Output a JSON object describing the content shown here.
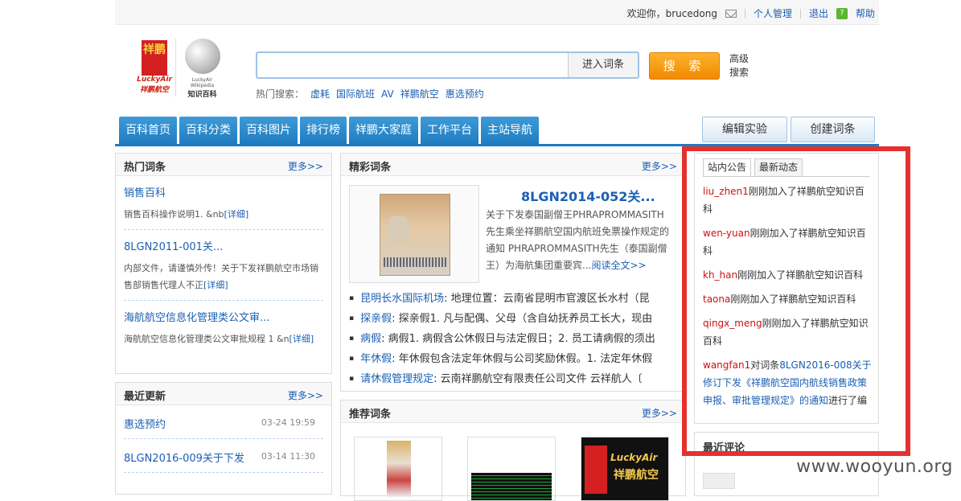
{
  "topbar": {
    "welcome": "欢迎你，brucedong",
    "mail_icon": "mail-icon",
    "personal": "个人管理",
    "logout": "退出",
    "help_icon": "?",
    "help": "帮助"
  },
  "logo": {
    "airline_chars": "祥鹏",
    "airline_en": "LuckyAir",
    "airline_cn": "祥鹏航空",
    "wiki_en": "LuckyAir Wikipedia",
    "wiki_cn": "知识百科"
  },
  "search": {
    "placeholder": "",
    "enter_label": "进入词条",
    "button": "搜 索",
    "advanced": "高级搜索",
    "hot_label": "热门搜索：",
    "hot_terms": [
      "虚耗",
      "国际航班",
      "AV",
      "祥鹏航空",
      "惠选预约"
    ]
  },
  "nav": {
    "items": [
      "百科首页",
      "百科分类",
      "百科图片",
      "排行榜",
      "祥鹏大家庭",
      "工作平台",
      "主站导航"
    ],
    "edit_lab": "编辑实验",
    "create": "创建词条"
  },
  "hot_entries": {
    "title": "热门词条",
    "more": "更多>>",
    "items": [
      {
        "title": "销售百科",
        "desc": "销售百科操作说明1.   &nb",
        "link": "[详细]"
      },
      {
        "title": "8LGN2011-001关...",
        "desc": "内部文件，请谨慎外传！关于下发祥鹏航空市场销售部销售代理人不正",
        "link": "[详细]"
      },
      {
        "title": "海航航空信息化管理类公文审...",
        "desc": "海航航空信息化管理类公文审批规程 1 &n",
        "link": "[详细]"
      }
    ]
  },
  "recent_updates": {
    "title": "最近更新",
    "more": "更多>>",
    "items": [
      {
        "title": "惠选预约",
        "date": "03-24 19:59"
      },
      {
        "title": "8LGN2016-009关于下发",
        "date": "03-14 11:30"
      }
    ]
  },
  "featured": {
    "title": "精彩词条",
    "more": "更多>>",
    "entry_title": "8LGN2014-052关...",
    "entry_desc": "关于下发泰国副僧王PHRAPROMMASITH先生乘坐祥鹏航空国内航班免票操作规定的通知 PHRAPROMMASITH先生（泰国副僧王）为海航集团重要宾...",
    "read_more": "阅读全文>>",
    "list": [
      {
        "name": "昆明长水国际机场",
        "text": "地理位置：云南省昆明市官渡区长水村（昆"
      },
      {
        "name": "探亲假",
        "text": "探亲假1. 凡与配偶、父母（含自幼抚养员工长大，现由"
      },
      {
        "name": "病假",
        "text": "病假1. 病假含公休假日与法定假日；2. 员工请病假的须出"
      },
      {
        "name": "年休假",
        "text": "年休假包含法定年休假与公司奖励休假。1. 法定年休假"
      },
      {
        "name": "请休假管理规定",
        "text": "  云南祥鹏航空有限责任公司文件  云祥航人〔"
      }
    ]
  },
  "recommended": {
    "title": "推荐词条",
    "more": "更多>>"
  },
  "activity": {
    "tab_notice": "站内公告",
    "tab_latest": "最新动态",
    "items": [
      {
        "user": "liu_zhen1",
        "text": "刚刚加入了祥鹏航空知识百科"
      },
      {
        "user": "wen-yuan",
        "text": "刚刚加入了祥鹏航空知识百科"
      },
      {
        "user": "kh_han",
        "text": "刚刚加入了祥鹏航空知识百科"
      },
      {
        "user": "taona",
        "text": "刚刚加入了祥鹏航空知识百科"
      },
      {
        "user": "qingx_meng",
        "text": "刚刚加入了祥鹏航空知识百科"
      }
    ],
    "last": {
      "user": "wangfan1",
      "pre": "对词条",
      "link": "8LGN2016-008关于修订下发《祥鹏航空国内航线销售政策申报、审批管理规定》的通知",
      "post": "进行了编辑，奖情面多人困此受益"
    }
  },
  "recent_comments": {
    "title": "最近评论"
  },
  "watermark": "www.wooyun.org",
  "colors": {
    "nav_blue": "#1f7cc0",
    "link_blue": "#1a5fb4",
    "search_orange": "#f08a00",
    "highlight_red": "#e63030",
    "user_red": "#cc1111"
  }
}
